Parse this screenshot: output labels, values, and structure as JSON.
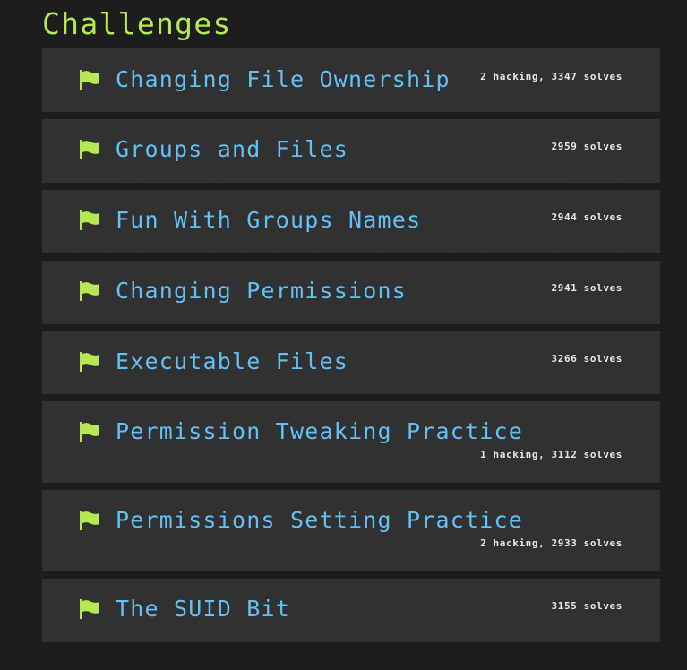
{
  "section": {
    "title": "Challenges"
  },
  "challenges": [
    {
      "title": "Changing File Ownership",
      "solves": "2 hacking, 3347 solves"
    },
    {
      "title": "Groups and Files",
      "solves": "2959 solves"
    },
    {
      "title": "Fun With Groups Names",
      "solves": "2944 solves"
    },
    {
      "title": "Changing Permissions",
      "solves": "2941 solves"
    },
    {
      "title": "Executable Files",
      "solves": "3266 solves"
    },
    {
      "title": "Permission Tweaking Practice",
      "solves": "1 hacking, 3112 solves"
    },
    {
      "title": "Permissions Setting Practice",
      "solves": "2 hacking, 2933 solves"
    },
    {
      "title": "The SUID Bit",
      "solves": "3155 solves"
    }
  ],
  "colors": {
    "accent": "#b5e853",
    "link": "#63c0f5",
    "card": "#313131",
    "background": "#1c1c1c"
  },
  "icons": {
    "challenge": "flag-icon"
  }
}
